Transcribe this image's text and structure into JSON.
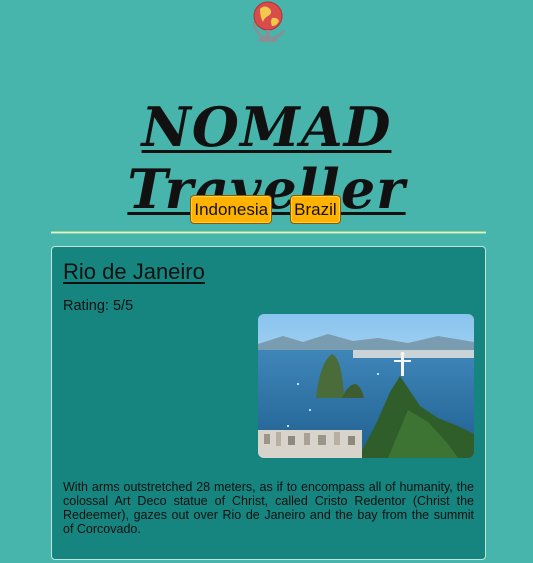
{
  "header": {
    "logo_icon": "globe-icon",
    "site_title": "NOMAD Traveller"
  },
  "nav": {
    "items": [
      {
        "label": "Indonesia"
      },
      {
        "label": "Brazil"
      }
    ]
  },
  "destination": {
    "title": "Rio de Janeiro",
    "rating": "Rating: 5/5",
    "image_icon": "rio-de-janeiro-photo",
    "description": "With arms outstretched 28 meters, as if to encompass all of humanity, the colossal Art Deco statue of Christ, called Cristo Redentor (Christ the Redeemer), gazes out over Rio de Janeiro and the bay from the summit of Corcovado."
  },
  "colors": {
    "background": "#48b5ad",
    "card_background": "#16857f",
    "nav_button": "#ffb300"
  }
}
